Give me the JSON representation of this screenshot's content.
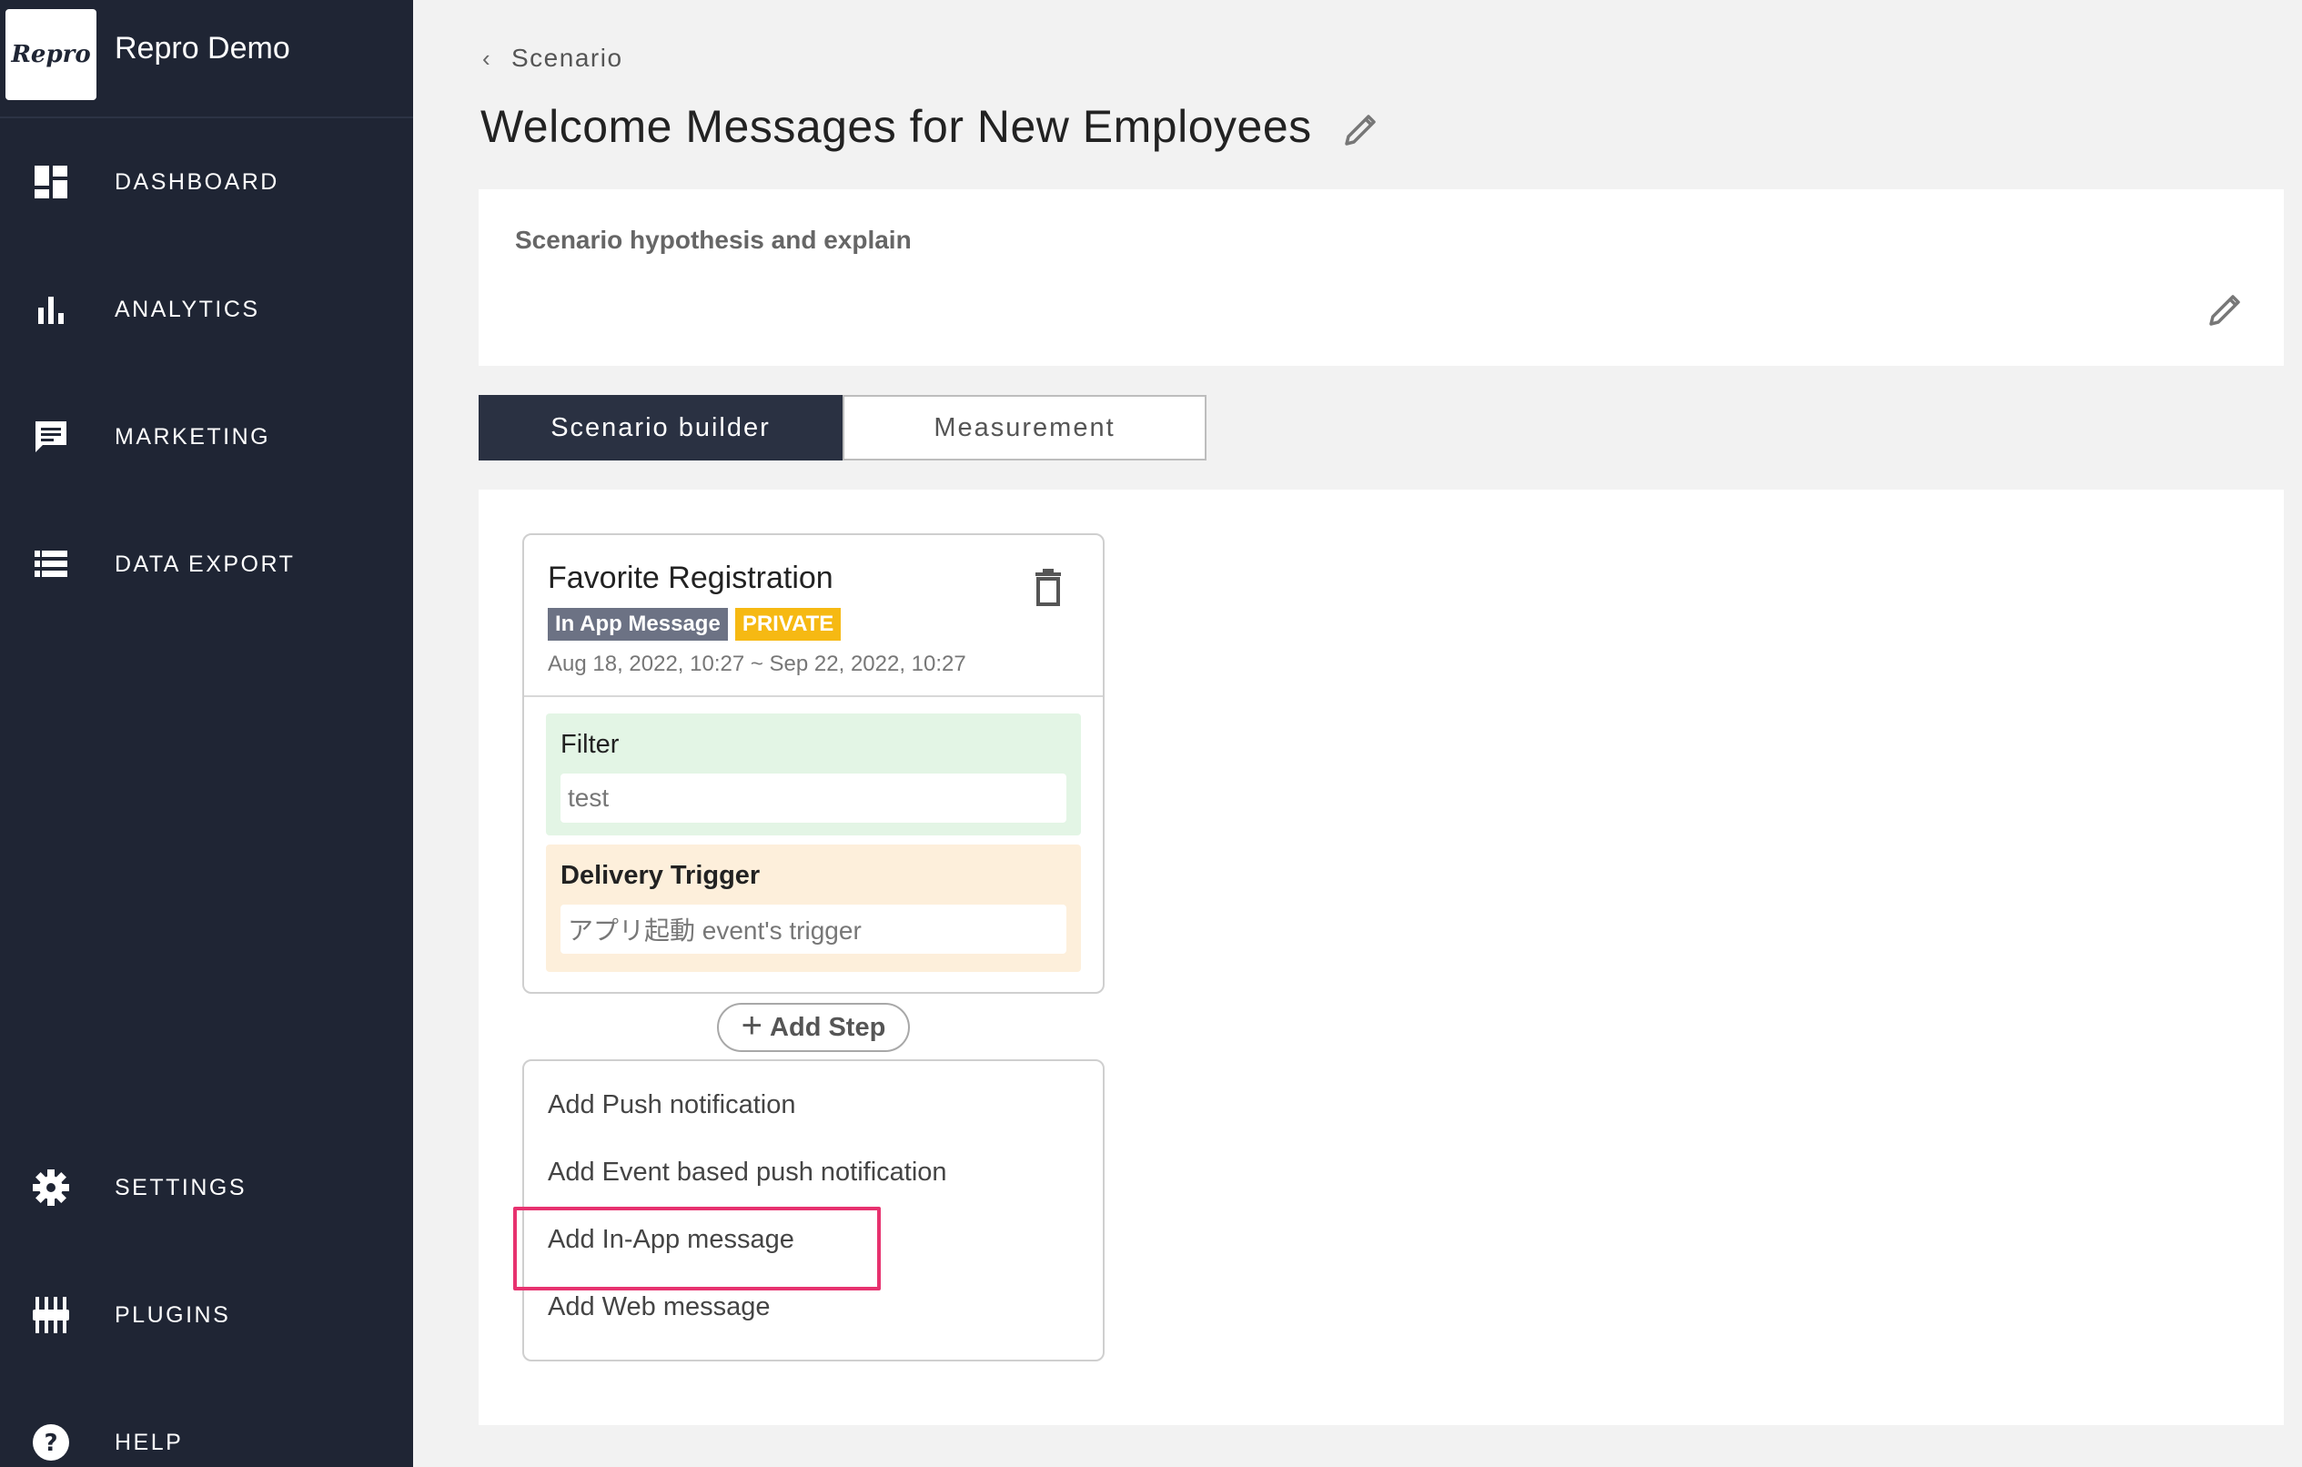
{
  "app": {
    "brand_logo_text": "Repro",
    "brand_name": "Repro Demo"
  },
  "sidebar": {
    "items": [
      {
        "label": "DASHBOARD",
        "icon": "dashboard-icon"
      },
      {
        "label": "ANALYTICS",
        "icon": "bar-chart-icon"
      },
      {
        "label": "MARKETING",
        "icon": "message-icon"
      },
      {
        "label": "DATA EXPORT",
        "icon": "list-icon"
      },
      {
        "label": "SETTINGS",
        "icon": "gear-icon"
      },
      {
        "label": "PLUGINS",
        "icon": "plugins-icon"
      },
      {
        "label": "HELP",
        "icon": "help-icon"
      }
    ]
  },
  "breadcrumb": {
    "label": "Scenario"
  },
  "page": {
    "title": "Welcome Messages for New Employees"
  },
  "hypothesis": {
    "label": "Scenario hypothesis and explain"
  },
  "tabs": [
    {
      "label": "Scenario builder",
      "active": true
    },
    {
      "label": "Measurement",
      "active": false
    }
  ],
  "step": {
    "name": "Favorite Registration",
    "type_badge": "In App Message",
    "status_badge": "PRIVATE",
    "dates": "Aug 18, 2022, 10:27 ~ Sep 22, 2022, 10:27",
    "filter": {
      "title": "Filter",
      "value": "test"
    },
    "trigger": {
      "title": "Delivery Trigger",
      "value": "アプリ起動 event's trigger"
    }
  },
  "add_step": {
    "label": "Add Step"
  },
  "add_menu": {
    "items": [
      "Add Push notification",
      "Add Event based push notification",
      "Add In-App message",
      "Add Web message"
    ],
    "highlighted_index": 2
  },
  "colors": {
    "sidebar_bg": "#1f2534",
    "active_tab_bg": "#2a3142",
    "filter_bg": "#e3f5e5",
    "trigger_bg": "#fdefdb",
    "private_badge": "#f6b913",
    "type_badge": "#6c7284",
    "highlight_border": "#e7326f"
  }
}
